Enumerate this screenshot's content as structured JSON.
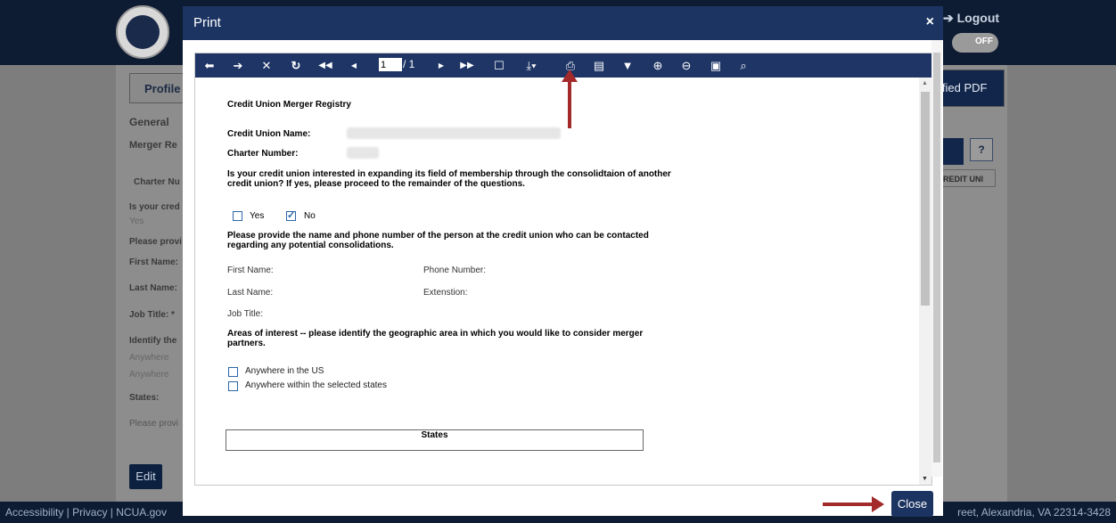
{
  "background": {
    "logout": "➔ Logout",
    "toggle": "OFF",
    "profile_button": "Profile",
    "tab_general": "General",
    "merger_label": "Merger Re",
    "charter_col": "Charter Nu",
    "pdf_button": "ified PDF",
    "credit_uni": "REDIT UNI",
    "help": "?",
    "q_is_your": "Is your cred",
    "yes": "Yes",
    "please_provide": "Please provi",
    "first_name": "First Name:",
    "last_name": "Last Name:",
    "job_title": "Job Title: *",
    "identify": "Identify the",
    "anywhere1": "Anywhere",
    "anywhere2": "Anywhere",
    "states": "States:",
    "please_provide2": "Please provi",
    "edit": "Edit",
    "footer_left": "Accessibility | Privacy | NCUA.gov",
    "footer_right": "reet, Alexandria, VA 22314-3428"
  },
  "modal": {
    "title": "Print",
    "close_x": "×",
    "close_button": "Close"
  },
  "toolbar": {
    "page_value": "1",
    "page_count": "/ 1"
  },
  "document": {
    "heading": "Credit Union Merger Registry",
    "cu_name_label": "Credit Union Name:",
    "charter_label": "Charter Number:",
    "question": "Is your credit union interested in expanding its field of membership through the consolidtaion of another credit union? If yes, please proceed to the remainder of the questions.",
    "yes": "Yes",
    "no": "No",
    "yes_checked": false,
    "no_checked": true,
    "contact_prompt": "Please provide the name and phone number of the person at the credit union who can be contacted regarding any potential consolidations.",
    "first_name": "First Name:",
    "phone_number": "Phone Number:",
    "last_name": "Last Name:",
    "extension": "Extenstion:",
    "job_title": "Job Title:",
    "areas_prompt": "Areas of interest -- please identify the geographic area in which you would like to consider merger partners.",
    "anywhere_us": "Anywhere in the US",
    "anywhere_states": "Anywhere within the selected states",
    "states_header": "States"
  },
  "colors": {
    "accent": "#1c3461",
    "annotation": "#a32a2a",
    "checkbox": "#2b66a8"
  }
}
